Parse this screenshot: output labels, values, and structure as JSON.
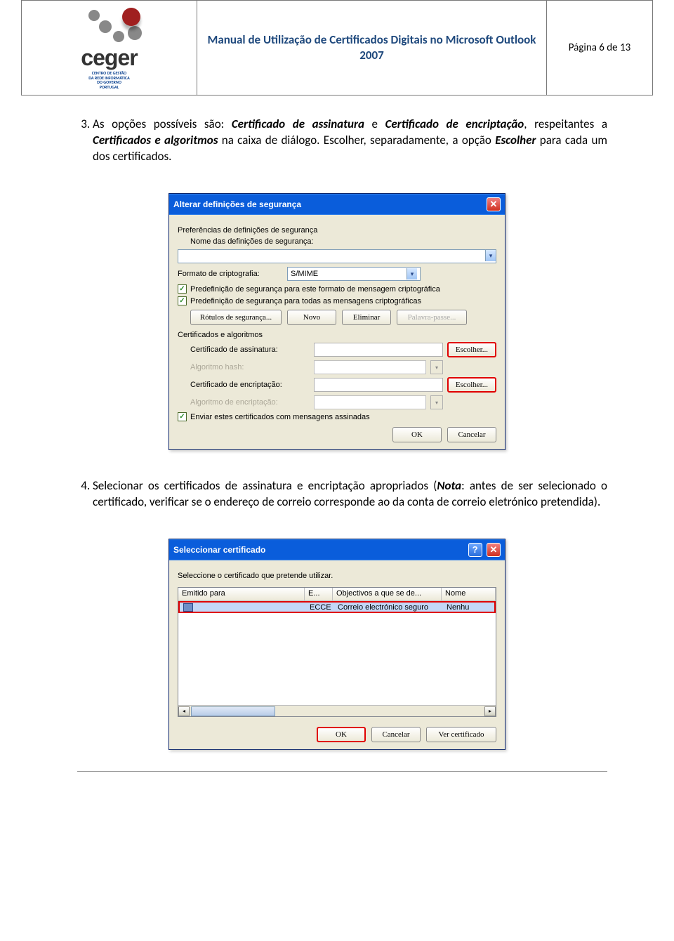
{
  "header": {
    "logo_word": "ceger",
    "logo_sub1": "CENTRO DE GESTÃO",
    "logo_sub2": "DA REDE INFORMÁTICA",
    "logo_sub3": "DO GOVERNO",
    "logo_sub4": "PORTUGAL",
    "title": "Manual de Utilização de Certificados Digitais no Microsoft Outlook 2007",
    "page": "Página 6 de 13"
  },
  "para3_prefix": "As opções possíveis são: ",
  "para3_term1": "Certificado de assinatura",
  "para3_mid1": " e ",
  "para3_term2": "Certificado de encriptação",
  "para3_mid2": ", respeitantes a ",
  "para3_term3": "Certificados e algoritmos",
  "para3_mid3": " na caixa de diálogo. Escolher, separadamente, a opção ",
  "para3_term4": "Escolher",
  "para3_suffix": " para cada um dos certificados.",
  "para4_prefix": "Selecionar os certificados de assinatura e encriptação apropriados (",
  "para4_nota": "Nota",
  "para4_suffix": ": antes de ser selecionado o certificado, verificar se o endereço de correio corresponde ao da conta de correio eletrónico pretendida).",
  "dlg1": {
    "title": "Alterar definições de segurança",
    "pref_label": "Preferências de definições de segurança",
    "name_label": "Nome das definições de segurança:",
    "format_label": "Formato de criptografia:",
    "format_value": "S/MIME",
    "chk1": "Predefinição de segurança para este formato de mensagem criptográfica",
    "chk2": "Predefinição de segurança para todas as mensagens criptográficas",
    "btn_labels": "Rótulos de segurança...",
    "btn_novo": "Novo",
    "btn_eliminar": "Eliminar",
    "btn_pass": "Palavra-passe...",
    "certs_label": "Certificados e algoritmos",
    "cert_sign": "Certificado de assinatura:",
    "hash": "Algoritmo hash:",
    "cert_enc": "Certificado de encriptação:",
    "alg_enc": "Algoritmo de encriptação:",
    "btn_escolher": "Escolher...",
    "chk3": "Enviar estes certificados com mensagens assinadas",
    "btn_ok": "OK",
    "btn_cancel": "Cancelar"
  },
  "dlg2": {
    "title": "Seleccionar certificado",
    "intro": "Seleccione o certificado que pretende utilizar.",
    "col1": "Emitido para",
    "col2": "E...",
    "col3": "Objectivos a que se de...",
    "col4": "Nome",
    "row_col1": "",
    "row_col2": "ECCE",
    "row_col3": "Correio electrónico seguro",
    "row_col4": "Nenhu",
    "btn_ok": "OK",
    "btn_cancel": "Cancelar",
    "btn_view": "Ver certificado"
  }
}
